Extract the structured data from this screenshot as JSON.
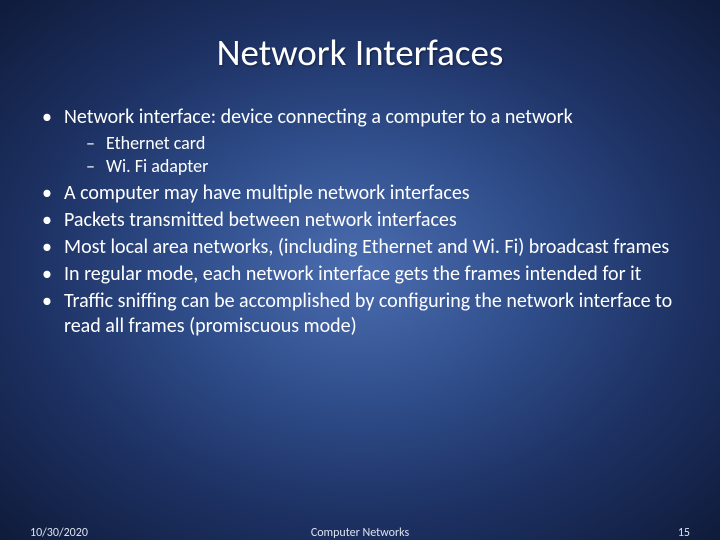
{
  "title": "Network Interfaces",
  "bullets": {
    "b1": "Network interface: device connecting a computer to a network",
    "b1_sub1": "Ethernet card",
    "b1_sub2": "Wi. Fi adapter",
    "b2": "A computer may have multiple network interfaces",
    "b3": "Packets transmitted between network interfaces",
    "b4": "Most local area networks, (including Ethernet and Wi. Fi) broadcast frames",
    "b5": "In regular mode, each network interface gets the frames intended for it",
    "b6_pre": "Traffic sniffing can be accomplished by configuring the network interface to read all frames (",
    "b6_link": "promiscuous mode",
    "b6_post": ")"
  },
  "footer": {
    "date": "10/30/2020",
    "center": "Computer Networks",
    "page": "15"
  }
}
